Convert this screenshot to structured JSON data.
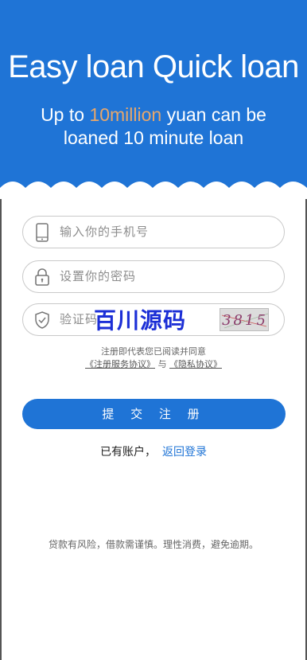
{
  "banner": {
    "headline": "Easy loan Quick loan",
    "sub_pre": "Up to ",
    "sub_highlight": "10million",
    "sub_post": " yuan can be",
    "sub_line2": "loaned 10 minute loan",
    "bg_color": "#1f74d6",
    "highlight_color": "#e8a76a"
  },
  "form": {
    "phone_placeholder": "输入你的手机号",
    "password_placeholder": "设置你的密码",
    "code_placeholder": "验证码",
    "captcha_text": "3815",
    "watermark": "百川源码"
  },
  "agreement": {
    "line1": "注册即代表您已阅读并同意",
    "service_link": "《注册服务协议》",
    "and_text": "与",
    "privacy_link": "《隐私协议》"
  },
  "submit_label": "提 交 注 册",
  "login": {
    "prompt": "已有账户，",
    "link": "返回登录"
  },
  "notice": "贷款有风险，借款需谨慎。理性消费，避免逾期。"
}
